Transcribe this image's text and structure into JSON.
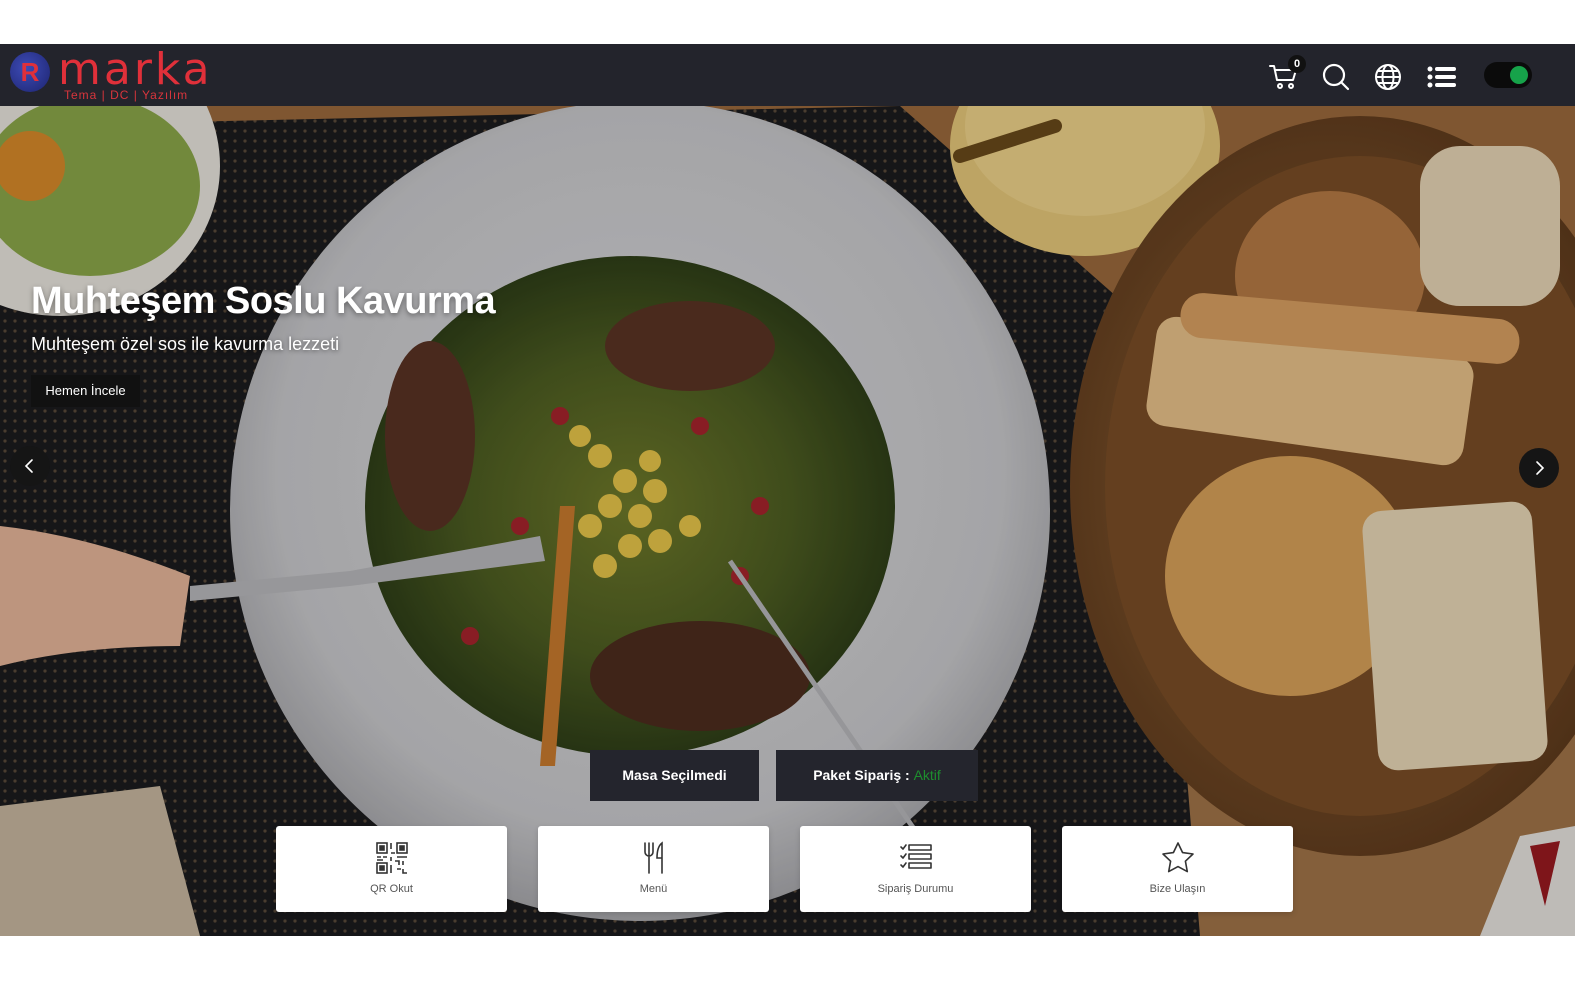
{
  "brand": {
    "logo_letter": "R",
    "name": "marka",
    "tagline": "Tema | DC | Yazılım",
    "accent_color": "#e0303a"
  },
  "navbar": {
    "cart_count": "0",
    "icons": [
      "cart-icon",
      "search-icon",
      "globe-icon",
      "list-icon"
    ],
    "toggle_on": true,
    "toggle_color": "#16a34a"
  },
  "hero": {
    "title": "Muhteşem Soslu Kavurma",
    "subtitle": "Muhteşem özel sos ile kavurma lezzeti",
    "button_label": "Hemen İncele",
    "prev_icon": "chevron-left-icon",
    "next_icon": "chevron-right-icon"
  },
  "status": {
    "table_label": "Masa Seçilmedi",
    "package_label": "Paket Sipariş :",
    "package_status": "Aktif",
    "package_status_color": "#1e8e2e"
  },
  "quick_actions": [
    {
      "label": "QR Okut",
      "icon": "qr-code-icon"
    },
    {
      "label": "Menü",
      "icon": "fork-knife-icon"
    },
    {
      "label": "Sipariş Durumu",
      "icon": "checklist-icon"
    },
    {
      "label": "Bize Ulaşın",
      "icon": "star-icon"
    }
  ]
}
